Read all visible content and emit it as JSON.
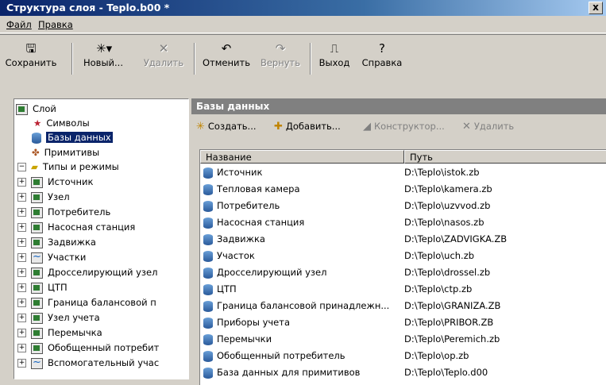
{
  "window": {
    "title": "Структура слоя - Teplo.b00 *",
    "close": "x"
  },
  "menu": {
    "file": "Файл",
    "edit": "Правка"
  },
  "toolbar": {
    "save": "Сохранить",
    "new": "Новый...",
    "delete": "Удалить",
    "undo": "Отменить",
    "redo": "Вернуть",
    "exit": "Выход",
    "help": "Справка"
  },
  "tree": {
    "root": "Слой",
    "symbols": "Символы",
    "databases": "Базы данных",
    "primitives": "Примитивы",
    "types": "Типы и режимы",
    "children": [
      {
        "label": "Источник",
        "icon": "table-icon"
      },
      {
        "label": "Узел",
        "icon": "table-icon"
      },
      {
        "label": "Потребитель",
        "icon": "table-icon"
      },
      {
        "label": "Насосная станция",
        "icon": "table-icon"
      },
      {
        "label": "Задвижка",
        "icon": "table-icon"
      },
      {
        "label": "Участки",
        "icon": "wave-icon"
      },
      {
        "label": "Дросселирующий узел",
        "icon": "table-icon"
      },
      {
        "label": "ЦТП",
        "icon": "table-icon"
      },
      {
        "label": "Граница балансовой п",
        "icon": "table-icon"
      },
      {
        "label": "Узел учета",
        "icon": "table-icon"
      },
      {
        "label": "Перемычка",
        "icon": "table-icon"
      },
      {
        "label": "Обобщенный потребит",
        "icon": "table-icon"
      },
      {
        "label": "Вспомогательный учас",
        "icon": "wave-icon"
      }
    ]
  },
  "pane": {
    "title": "Базы данных",
    "create": "Создать...",
    "add": "Добавить...",
    "constructor": "Конструктор...",
    "delete": "Удалить"
  },
  "list": {
    "columns": [
      "Название",
      "Путь"
    ],
    "rows": [
      [
        "Источник",
        "D:\\Teplo\\istok.zb"
      ],
      [
        "Тепловая камера",
        "D:\\Teplo\\kamera.zb"
      ],
      [
        "Потребитель",
        "D:\\Teplo\\uzvvod.zb"
      ],
      [
        "Насосная станция",
        "D:\\Teplo\\nasos.zb"
      ],
      [
        "Задвижка",
        "D:\\Teplo\\ZADVIGKA.ZB"
      ],
      [
        "Участок",
        "D:\\Teplo\\uch.zb"
      ],
      [
        "Дросселирующий узел",
        "D:\\Teplo\\drossel.zb"
      ],
      [
        "ЦТП",
        "D:\\Teplo\\ctp.zb"
      ],
      [
        "Граница балансовой принадлежн...",
        "D:\\Teplo\\GRANIZA.ZB"
      ],
      [
        "Приборы учета",
        "D:\\Teplo\\PRIBOR.ZB"
      ],
      [
        "Перемычки",
        "D:\\Teplo\\Peremich.zb"
      ],
      [
        "Обобщенный потребитель",
        "D:\\Teplo\\op.zb"
      ],
      [
        "База данных для примитивов",
        "D:\\Teplo\\Teplo.d00"
      ]
    ]
  }
}
